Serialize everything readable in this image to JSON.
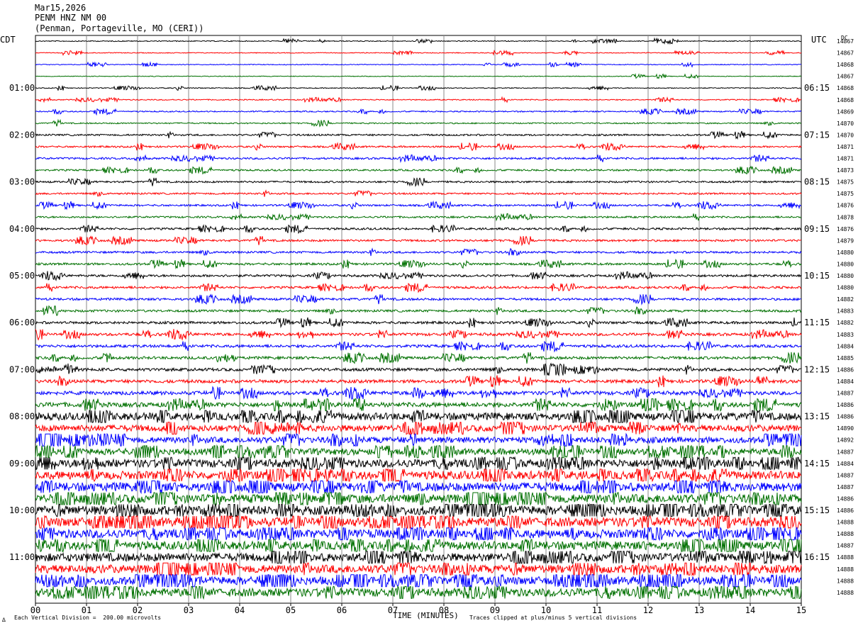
{
  "header": {
    "date": "Mar15,2026",
    "station": "PENM HNZ NM 00",
    "location": "(Penman, Portageville, MO (CERI))"
  },
  "left_zone_label": "CDT",
  "right_zone_label": "UTC",
  "dc_label": "DC",
  "chart_data": {
    "type": "line",
    "title": "",
    "xlabel": "TIME (MINUTES)",
    "ylabel": "",
    "x_ticks": [
      "00",
      "01",
      "02",
      "03",
      "04",
      "05",
      "06",
      "07",
      "08",
      "09",
      "10",
      "11",
      "12",
      "13",
      "14",
      "15"
    ],
    "xlim": [
      0,
      15
    ],
    "grid": "vertical lines at each minute",
    "trace_count": 48,
    "trace_interval_minutes": 15,
    "trace_colors_cycle": [
      "#000000",
      "#ff0000",
      "#0000ff",
      "#007000"
    ],
    "left_time_labels": [
      {
        "trace": 4,
        "text": "01:00"
      },
      {
        "trace": 8,
        "text": "02:00"
      },
      {
        "trace": 12,
        "text": "03:00"
      },
      {
        "trace": 16,
        "text": "04:00"
      },
      {
        "trace": 20,
        "text": "05:00"
      },
      {
        "trace": 24,
        "text": "06:00"
      },
      {
        "trace": 28,
        "text": "07:00"
      },
      {
        "trace": 32,
        "text": "08:00"
      },
      {
        "trace": 36,
        "text": "09:00"
      },
      {
        "trace": 40,
        "text": "10:00"
      },
      {
        "trace": 44,
        "text": "11:00"
      }
    ],
    "right_time_labels": [
      {
        "trace": 4,
        "text": "06:15"
      },
      {
        "trace": 8,
        "text": "07:15"
      },
      {
        "trace": 12,
        "text": "08:15"
      },
      {
        "trace": 16,
        "text": "09:15"
      },
      {
        "trace": 20,
        "text": "10:15"
      },
      {
        "trace": 24,
        "text": "11:15"
      },
      {
        "trace": 28,
        "text": "12:15"
      },
      {
        "trace": 32,
        "text": "13:15"
      },
      {
        "trace": 36,
        "text": "14:15"
      },
      {
        "trace": 40,
        "text": "15:15"
      },
      {
        "trace": 44,
        "text": "16:15"
      }
    ],
    "dc_values": [
      "14867",
      "14867",
      "14868",
      "14867",
      "14868",
      "14868",
      "14869",
      "14870",
      "14870",
      "14871",
      "14871",
      "14873",
      "14875",
      "14875",
      "14876",
      "14878",
      "14876",
      "14879",
      "14880",
      "14880",
      "14880",
      "14880",
      "14882",
      "14883",
      "14882",
      "14883",
      "14884",
      "14885",
      "14886",
      "14884",
      "14887",
      "14886",
      "14886",
      "14890",
      "14892",
      "14887",
      "14884",
      "14887",
      "14887",
      "14886",
      "14886",
      "14888",
      "14888",
      "14887",
      "14888",
      "14888",
      "14888",
      "14888"
    ],
    "trace_noise_levels": [
      0.4,
      0.35,
      0.35,
      0.3,
      0.4,
      0.45,
      0.55,
      0.55,
      0.75,
      0.75,
      0.85,
      0.75,
      0.8,
      0.75,
      0.8,
      0.8,
      0.9,
      0.9,
      0.9,
      0.95,
      1.0,
      1.0,
      1.0,
      1.0,
      1.1,
      1.2,
      1.2,
      1.2,
      1.3,
      1.4,
      1.6,
      2.0,
      3.2,
      2.8,
      2.6,
      2.8,
      3.5,
      3.6,
      3.8,
      3.8,
      4.0,
      4.0,
      3.8,
      3.6,
      3.6,
      3.6,
      3.6,
      3.6
    ]
  },
  "footer": {
    "division_note": "Each Vertical Division =  200.00 microvolts",
    "clip_note": "Traces clipped at plus/minus 5 vertical divisions",
    "corner_mark": "∆"
  }
}
